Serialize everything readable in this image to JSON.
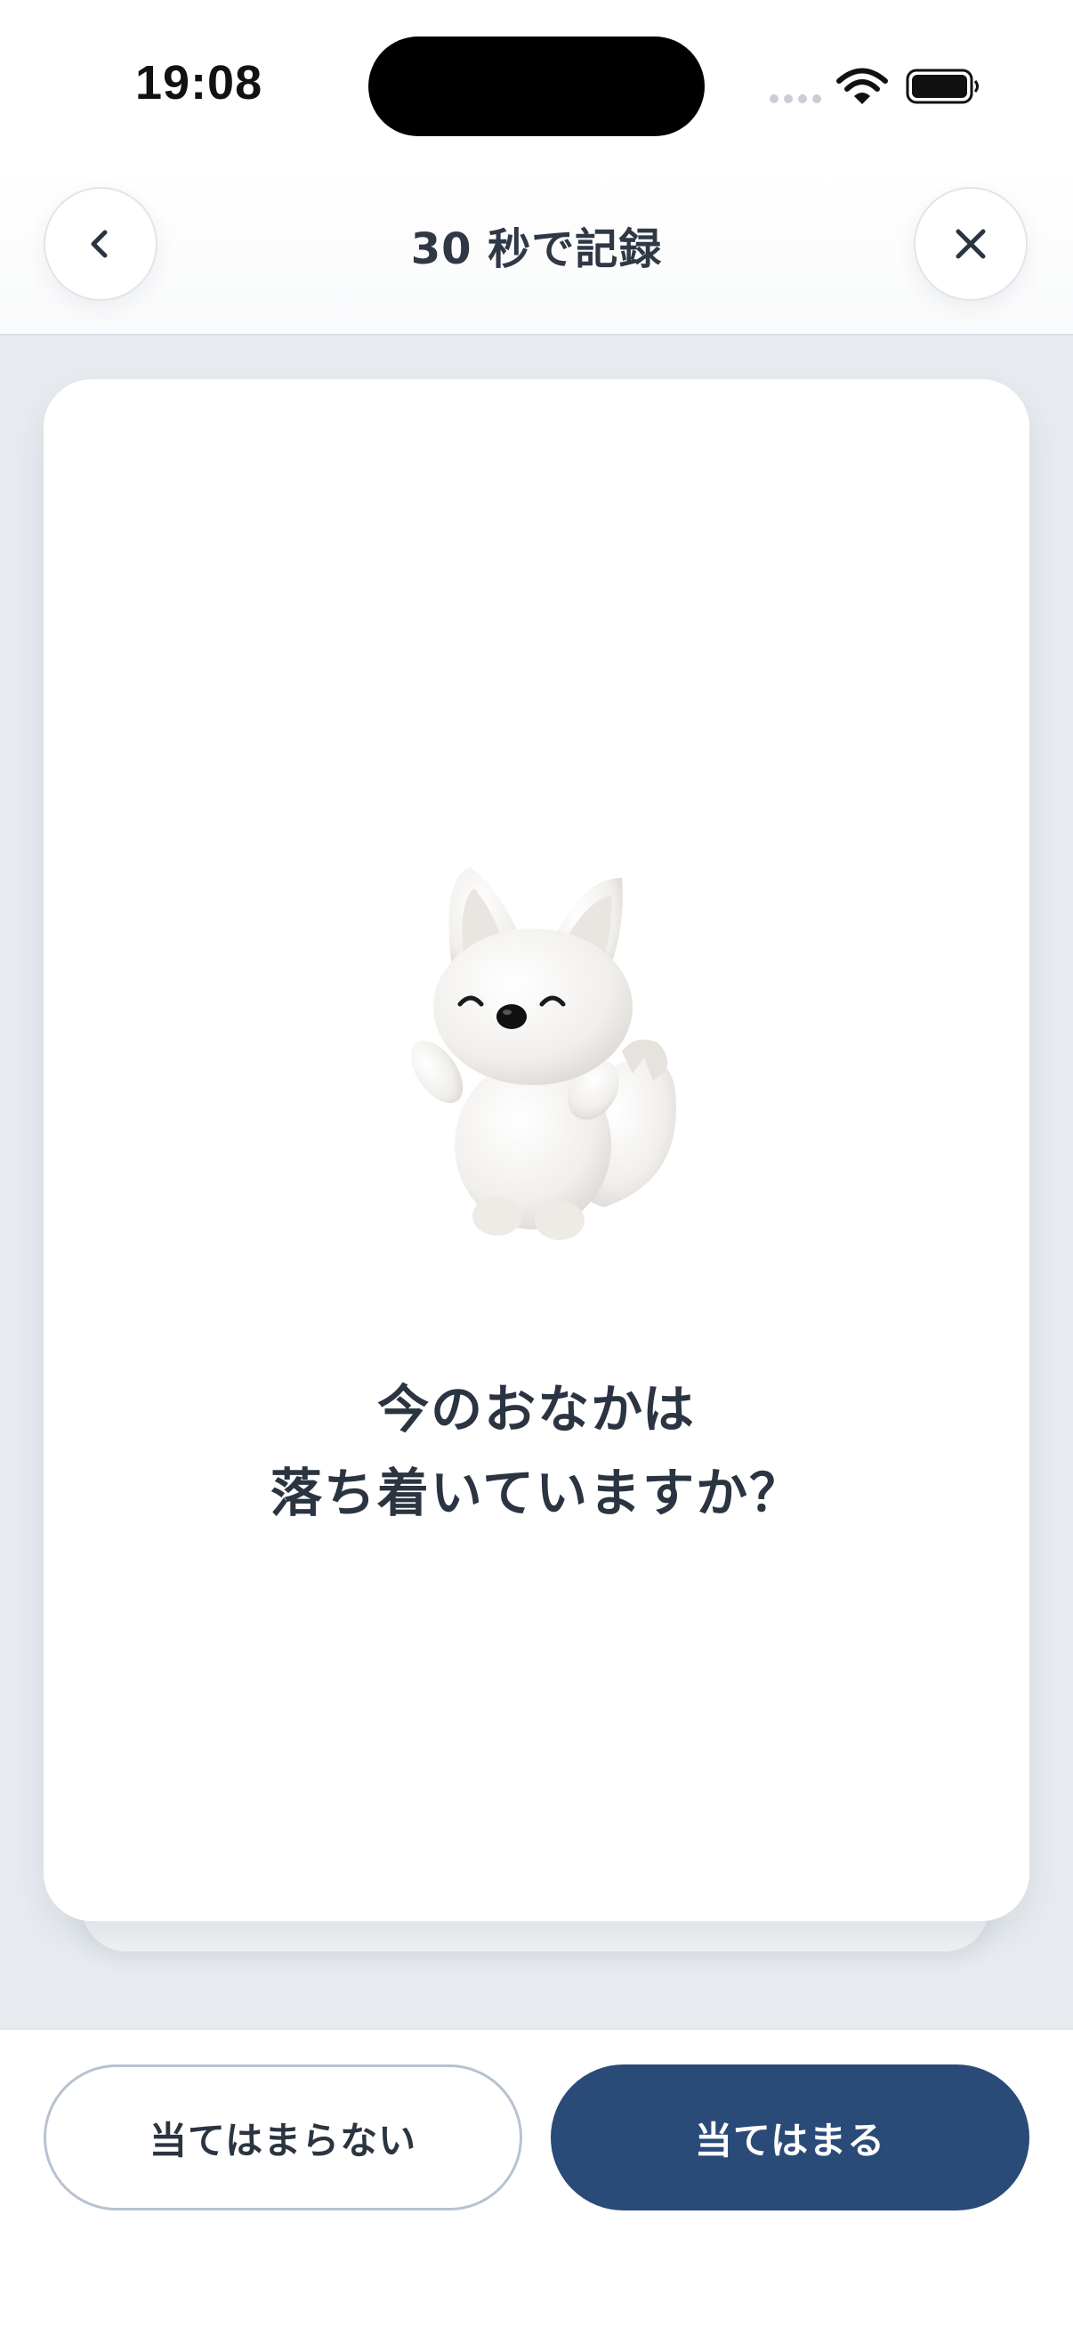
{
  "status_bar": {
    "time": "19:08"
  },
  "header": {
    "title": "30 秒で記録",
    "back_icon": "chevron-left-icon",
    "close_icon": "close-icon"
  },
  "card": {
    "mascot": "white-fox-mascot",
    "question_lines": [
      "今のおなかは",
      "落ち着いていますか？"
    ]
  },
  "actions": {
    "no_label": "当てはまらない",
    "yes_label": "当てはまる"
  },
  "colors": {
    "primary": "#2a4a78",
    "background": "#e8ecf1",
    "text": "#2b3441",
    "outline": "#b7c2d1"
  }
}
